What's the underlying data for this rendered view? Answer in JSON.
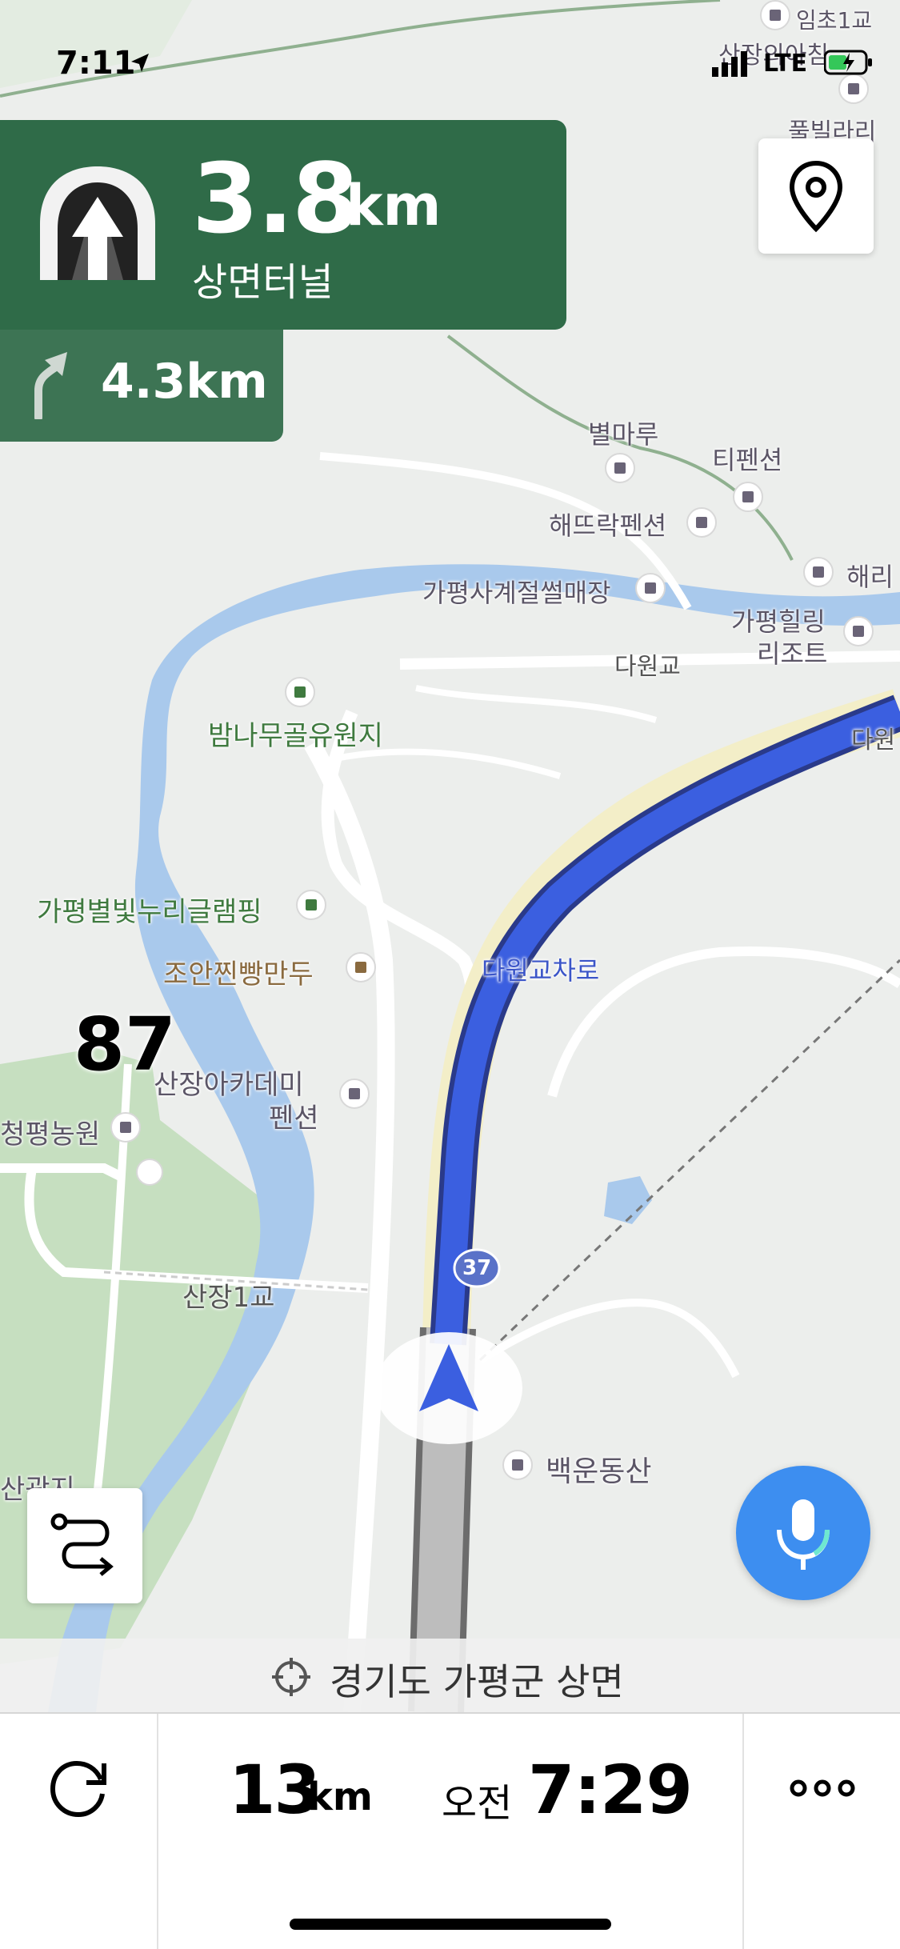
{
  "status": {
    "time": "7:11",
    "network": "LTE"
  },
  "guidance": {
    "distance_value": "3.8",
    "distance_unit": "km",
    "road_name": "상면터널",
    "next_distance": "4.3km"
  },
  "map": {
    "labels": {
      "imcho": "임초1교",
      "sanjang_top": "산장의아침",
      "pulbil": "풀빌라리",
      "byeolmaru": "별마루",
      "tipension": "티펜션",
      "haetteurak": "해뜨락펜션",
      "haeri": "해리",
      "gapyeong_store": "가평사계절썰매장",
      "healing_1": "가평힐링",
      "healing_2": "리조트",
      "dawongyo": "다원교",
      "dawon_right": "다원",
      "bamnamu": "밤나무골유원지",
      "glamping": "가평별빛누리글램핑",
      "joan": "조안찐빵만두",
      "dawon_ic": "다원교차로",
      "academy_1": "산장아카데미",
      "academy_2": "펜션",
      "farm": "청평농원",
      "sanjang1": "산장1교",
      "gwangji": "산광지",
      "baegun": "백운동산",
      "route_no": "37"
    },
    "speed_limit": "87",
    "address": "경기도 가평군 상면"
  },
  "trip": {
    "remaining_value": "13",
    "remaining_unit": "km",
    "eta_period": "오전",
    "eta_time": "7:29"
  },
  "colors": {
    "banner": "#2f6b48",
    "route": "#3b5fe0",
    "river": "#a9c9ec",
    "mic": "#3d8ef0"
  }
}
